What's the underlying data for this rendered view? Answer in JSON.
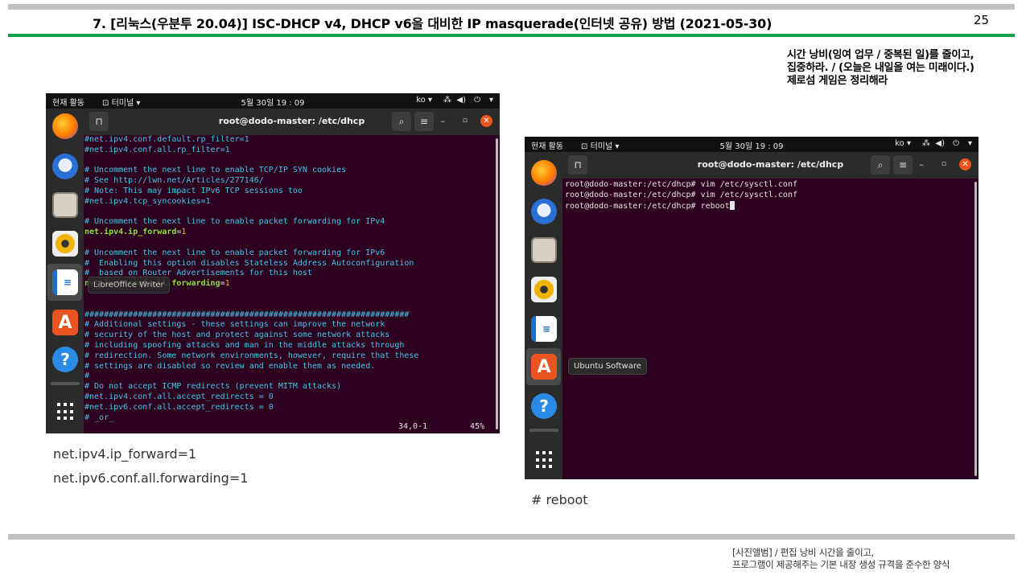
{
  "header": {
    "title": "7. [리눅스(우분투 20.04)] ISC-DHCP v4, DHCP v6을 대비한 IP masquerade(인터넷 공유) 방법 (2021-05-30)",
    "page_number": "25"
  },
  "motto": {
    "line1": "시간 낭비(잉여 업무 / 중복된 일)를 줄이고,",
    "line2": "집중하라. / (오늘은 내일을 여는 미래이다.)",
    "line3": "제로섬 게임은 정리해라"
  },
  "gnome_bar": {
    "activities": "현재 활동",
    "app_menu": "터미널 ▾",
    "clock": "5월 30일  19 : 09",
    "lang": "ko ▾",
    "network_icon": "network-icon",
    "volume_icon": "volume-icon",
    "power_icon": "power-icon"
  },
  "dock": {
    "apps": [
      "firefox-icon",
      "thunderbird-icon",
      "files-icon",
      "rhythmbox-icon",
      "libreoffice-writer-icon",
      "ubuntu-software-icon",
      "help-icon",
      "show-apps-icon"
    ]
  },
  "left_window": {
    "title": "root@dodo-master: /etc/dhcp",
    "lines": [
      "#net.ipv4.conf.default.rp_filter=1",
      "#net.ipv4.conf.all.rp_filter=1",
      "",
      "# Uncomment the next line to enable TCP/IP SYN cookies",
      "# See http://lwn.net/Articles/277146/",
      "# Note: This may impact IPv6 TCP sessions too",
      "#net.ipv4.tcp_syncookies=1",
      "",
      "# Uncomment the next line to enable packet forwarding for IPv4",
      "net.ipv4.ip_forward=1",
      "",
      "# Uncomment the next line to enable packet forwarding for IPv6",
      "#  Enabling this option disables Stateless Address Autoconfiguration",
      "#  based on Router Advertisements for this host",
      "net.ipv6.conf.all.forwarding=1",
      "",
      "",
      "###################################################################",
      "# Additional settings - these settings can improve the network",
      "# security of the host and protect against some network attacks",
      "# including spoofing attacks and man in the middle attacks through",
      "# redirection. Some network environments, however, require that these",
      "# settings are disabled so review and enable them as needed.",
      "#",
      "# Do not accept ICMP redirects (prevent MITM attacks)",
      "#net.ipv4.conf.all.accept_redirects = 0",
      "#net.ipv6.conf.all.accept_redirects = 0",
      "# _or_"
    ],
    "tooltip": "LibreOffice Writer",
    "status_position": "34,0-1",
    "status_percent": "45%"
  },
  "right_window": {
    "title": "root@dodo-master: /etc/dhcp",
    "lines": [
      "root@dodo-master:/etc/dhcp# vim /etc/sysctl.conf",
      "root@dodo-master:/etc/dhcp# vim /etc/sysctl.conf",
      "root@dodo-master:/etc/dhcp# reboot"
    ],
    "tooltip": "Ubuntu Software"
  },
  "captions": {
    "left_1": "net.ipv4.ip_forward=1",
    "left_2": "net.ipv6.conf.all.forwarding=1",
    "right": "# reboot"
  },
  "footer": {
    "line1": "[사진앨범] / 편집 낭비 시간을 줄이고,",
    "line2": "프로그램이 제공해주는 기본 내장 생성 규격을 준수한 양식"
  },
  "colors": {
    "terminal_bg": "#2c001e",
    "comment": "#46c8e8",
    "setting_key": "#8ae234",
    "setting_value": "#fcaf3e",
    "accent_green": "#17a14a",
    "close_orange": "#e95420"
  }
}
